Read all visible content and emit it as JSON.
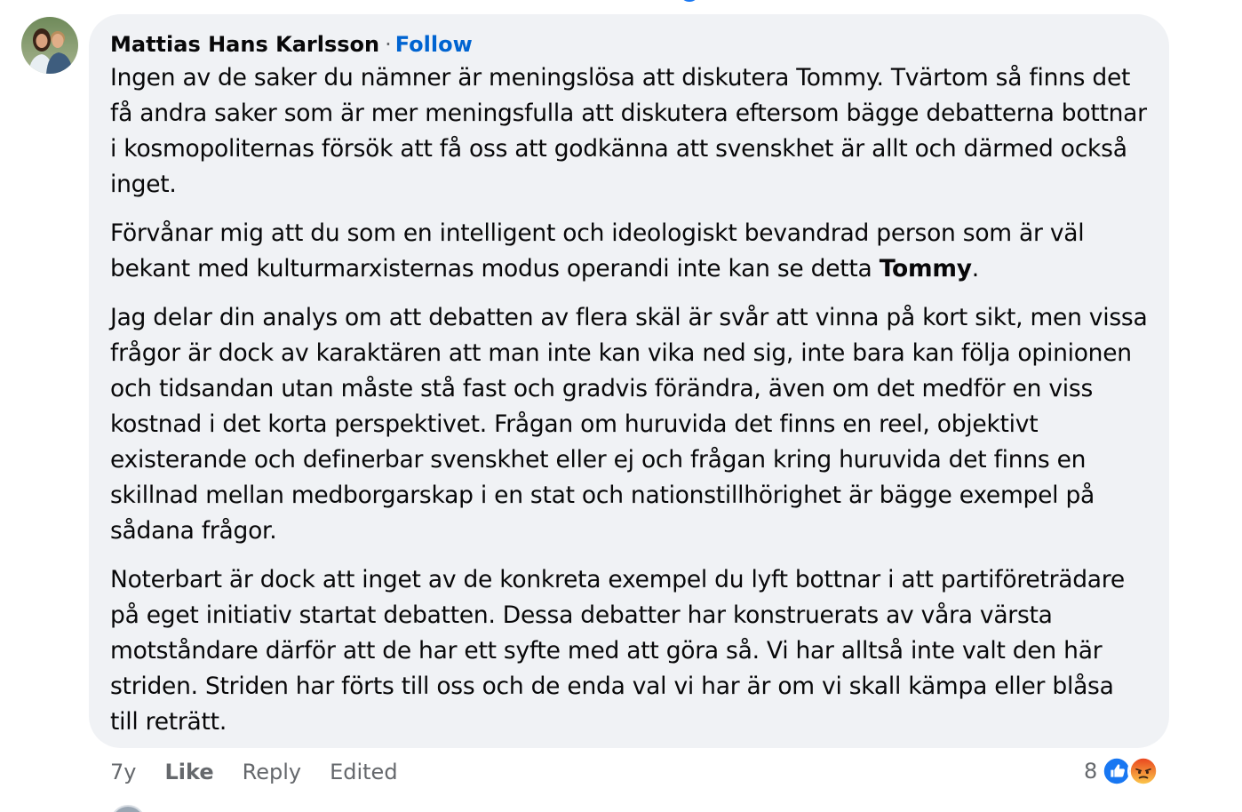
{
  "comment": {
    "author": "Mattias Hans Karlsson",
    "separator": "·",
    "follow_label": "Follow",
    "paragraphs": [
      "Ingen av de saker du nämner är meningslösa att diskutera Tommy. Tvärtom så finns det få andra saker som är mer meningsfulla att diskutera eftersom bägge debatterna bottnar i kosmopoliternas försök att få oss att godkänna att svenskhet är allt och därmed också inget.",
      "Jag delar din analys om att debatten av flera skäl är svår att vinna på kort sikt, men vissa frågor är dock av karaktären att man inte kan vika ned sig, inte bara kan följa opinionen och tidsandan utan måste stå fast och gradvis förändra, även om det medför en viss kostnad i det korta perspektivet. Frågan om huruvida det finns en reel, objektivt existerande och definerbar svenskhet eller ej och frågan kring huruvida det finns en skillnad mellan medborgarskap i en stat och nationstillhörighet är bägge exempel på sådana frågor.",
      "Noterbart är dock att inget av de konkreta exempel du lyft bottnar i att partiföreträdare på eget initiativ startat debatten. Dessa debatter har konstruerats av våra värsta motståndare därför att de har ett syfte med att göra så. Vi har alltså inte valt den här striden. Striden har förts till oss och de enda val vi har är om vi skall kämpa eller blåsa till reträtt."
    ],
    "paragraph2_before": "Förvånar mig att du som en intelligent och ideologiskt bevandrad person som är väl bekant med kulturmarxisternas modus operandi inte kan se detta ",
    "paragraph2_bold": "Tommy",
    "paragraph2_after": "."
  },
  "actions": {
    "time": "7y",
    "like_label": "Like",
    "reply_label": "Reply",
    "edited_label": "Edited"
  },
  "reactions": {
    "count": "8",
    "icons": [
      "like-reaction-icon",
      "angry-reaction-icon"
    ],
    "like_color": "#1877f2",
    "angry_color": "#f0643c"
  }
}
